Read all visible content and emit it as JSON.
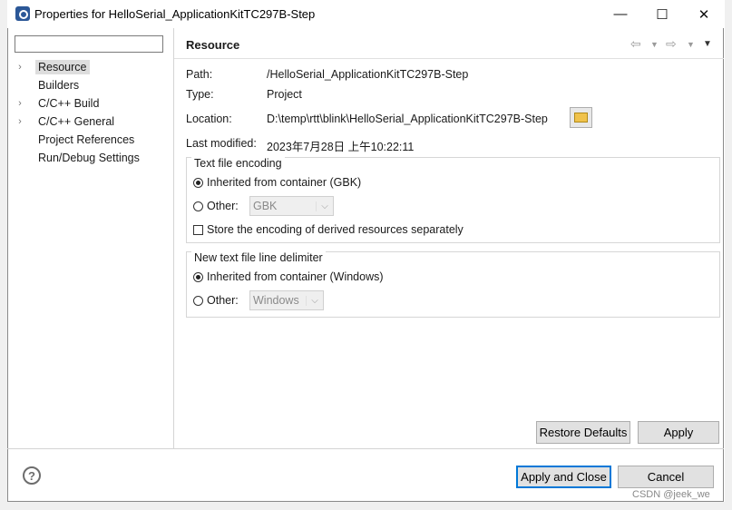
{
  "window": {
    "title": "Properties for HelloSerial_ApplicationKitTC297B-Step",
    "minimize_glyph": "—",
    "maximize_glyph": "☐",
    "close_glyph": "✕"
  },
  "sidebar": {
    "filter_value": "",
    "items": [
      {
        "label": "Resource",
        "expandable": true,
        "selected": true
      },
      {
        "label": "Builders",
        "expandable": false
      },
      {
        "label": "C/C++ Build",
        "expandable": true
      },
      {
        "label": "C/C++ General",
        "expandable": true
      },
      {
        "label": "Project References",
        "expandable": false
      },
      {
        "label": "Run/Debug Settings",
        "expandable": false
      }
    ]
  },
  "page": {
    "heading": "Resource",
    "nav_icons": {
      "back": "back-arrow-icon",
      "forward": "forward-arrow-icon",
      "menu": "view-menu-icon"
    },
    "path_label": "Path:",
    "path_value": "/HelloSerial_ApplicationKitTC297B-Step",
    "type_label": "Type:",
    "type_value": "Project",
    "location_label": "Location:",
    "location_value": "D:\\temp\\rtt\\blink\\HelloSerial_ApplicationKitTC297B-Step",
    "last_modified_label": "Last modified:",
    "last_modified_value": "2023年7月28日 上午10:22:11",
    "encoding_group": {
      "title": "Text file encoding",
      "inherited_label": "Inherited from container (GBK)",
      "other_label": "Other:",
      "other_value": "GBK",
      "store_label": "Store the encoding of derived resources separately"
    },
    "delimiter_group": {
      "title": "New text file line delimiter",
      "inherited_label": "Inherited from container (Windows)",
      "other_label": "Other:",
      "other_value": "Windows"
    },
    "restore_defaults": "Restore Defaults",
    "apply": "Apply"
  },
  "footer": {
    "help_glyph": "?",
    "apply_close": "Apply and Close",
    "cancel": "Cancel"
  },
  "watermark": "CSDN @jeek_we"
}
